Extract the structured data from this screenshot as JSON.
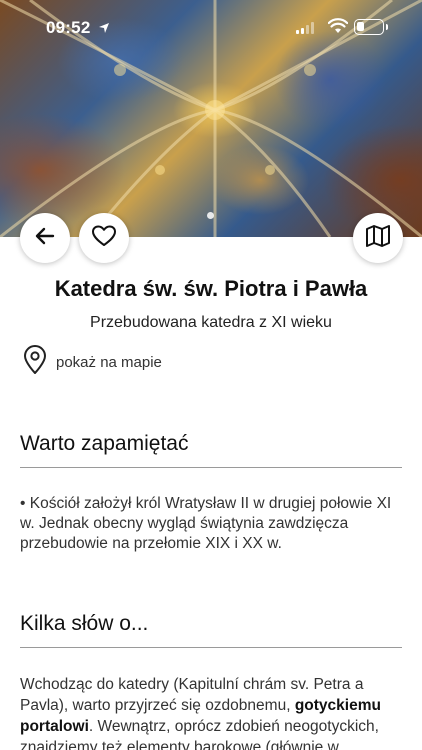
{
  "status": {
    "time": "09:52"
  },
  "colors": {
    "background": "#ffffff",
    "text": "#1a1a1a",
    "divider": "#9a9a9a"
  },
  "header": {
    "title": "Katedra św. św. Piotra i Pawła",
    "subtitle": "Przebudowana katedra z XI wieku"
  },
  "actions": {
    "back_icon": "arrow-left-icon",
    "favorite_icon": "heart-icon",
    "map_icon": "map-icon",
    "show_on_map_label": "pokaż na mapie"
  },
  "sections": {
    "remember": {
      "title": "Warto zapamiętać",
      "bullet": "• Kościół założył król Wratysław II w drugiej połowie XI w. Jednak obecny wygląd świątynia zawdzięcza przebudowie na przełomie XIX i XX w."
    },
    "about": {
      "title": "Kilka słów o...",
      "text_part1": "Wchodząc do katedry (Kapitulní chrám sv. Petra a Pavla), warto przyjrzeć się ozdobnemu, ",
      "text_bold": "gotyckiemu portalowi",
      "text_part2": ". Wewnątrz, oprócz zdobień neogotyckich, znajdziemy też elementy barokowe (głównie w"
    }
  }
}
